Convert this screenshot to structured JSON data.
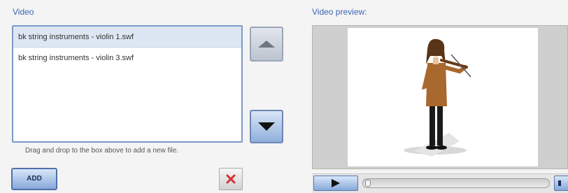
{
  "video_section": {
    "label": "Video",
    "files": [
      {
        "name": "bk string instruments - violin 1.swf",
        "selected": true
      },
      {
        "name": "bk string instruments - violin 3.swf",
        "selected": false
      }
    ],
    "hint": "Drag and drop to the box above to add a new file.",
    "add_label": "ADD"
  },
  "preview_section": {
    "label": "Video preview:",
    "progress": 0
  },
  "colors": {
    "label_blue": "#3c64b4",
    "button_blue": "#86a9da",
    "delete_red": "#d9303a"
  },
  "icons": {
    "move_up": "triangle-up",
    "move_down": "triangle-down",
    "delete": "red-x",
    "play": "play-triangle",
    "volume": "speaker"
  }
}
